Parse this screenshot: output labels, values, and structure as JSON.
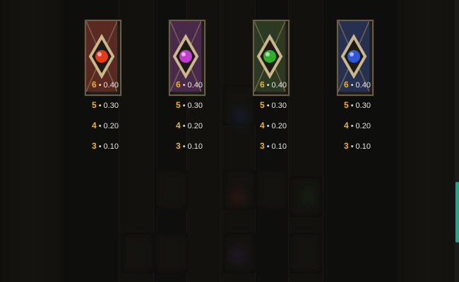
{
  "paytable": {
    "symbols": [
      {
        "icon": "red-gem-icon",
        "gem_color": "#e63a1a",
        "tile_tint": "#5a2a22",
        "payouts": [
          {
            "count": "6",
            "value": "0.40"
          },
          {
            "count": "5",
            "value": "0.30"
          },
          {
            "count": "4",
            "value": "0.20"
          },
          {
            "count": "3",
            "value": "0.10"
          }
        ]
      },
      {
        "icon": "purple-gem-icon",
        "gem_color": "#c23bd1",
        "tile_tint": "#4a2a4a",
        "payouts": [
          {
            "count": "6",
            "value": "0.40"
          },
          {
            "count": "5",
            "value": "0.30"
          },
          {
            "count": "4",
            "value": "0.20"
          },
          {
            "count": "3",
            "value": "0.10"
          }
        ]
      },
      {
        "icon": "green-gem-icon",
        "gem_color": "#2fae2a",
        "tile_tint": "#2c3a24",
        "payouts": [
          {
            "count": "6",
            "value": "0.40"
          },
          {
            "count": "5",
            "value": "0.30"
          },
          {
            "count": "4",
            "value": "0.20"
          },
          {
            "count": "3",
            "value": "0.10"
          }
        ]
      },
      {
        "icon": "blue-gem-icon",
        "gem_color": "#2f58d8",
        "tile_tint": "#263050",
        "payouts": [
          {
            "count": "6",
            "value": "0.40"
          },
          {
            "count": "5",
            "value": "0.30"
          },
          {
            "count": "4",
            "value": "0.20"
          },
          {
            "count": "3",
            "value": "0.10"
          }
        ]
      }
    ]
  },
  "colors": {
    "count_accent": "#f0b418",
    "scrollbar": "#1aa68c"
  }
}
